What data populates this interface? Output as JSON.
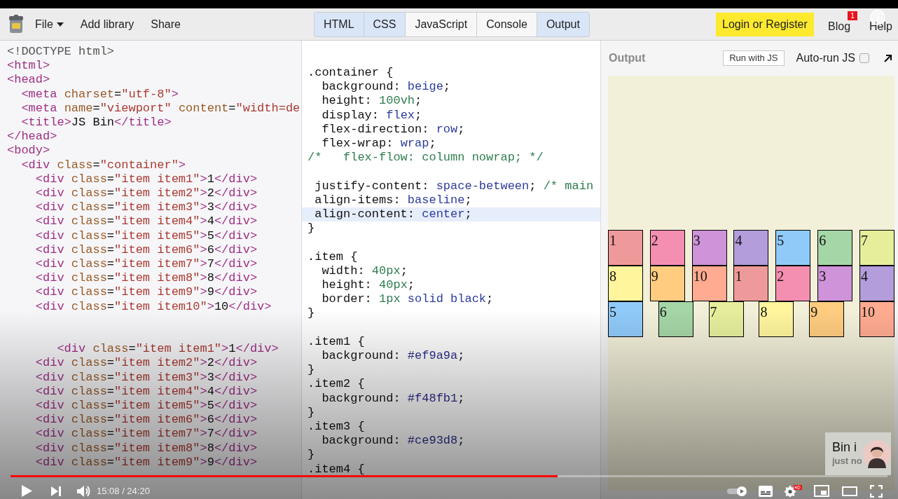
{
  "toolbar": {
    "menu": [
      {
        "label": "File",
        "kind": "dropdown"
      },
      {
        "label": "Add library",
        "kind": "link"
      },
      {
        "label": "Share",
        "kind": "link"
      }
    ],
    "tabs": [
      {
        "label": "HTML",
        "selected": true
      },
      {
        "label": "CSS",
        "selected": true
      },
      {
        "label": "JavaScript",
        "selected": false
      },
      {
        "label": "Console",
        "selected": false
      },
      {
        "label": "Output",
        "selected": true
      }
    ],
    "login": "Login or Register",
    "blog": {
      "label": "Blog",
      "badge": "1"
    },
    "help": "Help"
  },
  "html_editor": {
    "lines": [
      {
        "kind": "code",
        "text": "<!DOCTYPE html>"
      },
      {
        "kind": "code",
        "text": "<html>"
      },
      {
        "kind": "code",
        "text": "<head>"
      },
      {
        "kind": "code",
        "text": "  <meta charset=\"utf-8\">"
      },
      {
        "kind": "code",
        "text": "  <meta name=\"viewport\" content=\"width=de"
      },
      {
        "kind": "code",
        "text": "  <title>JS Bin</title>"
      },
      {
        "kind": "code",
        "text": "</head>"
      },
      {
        "kind": "code",
        "text": "<body>"
      },
      {
        "kind": "code",
        "text": "  <div class=\"container\">"
      },
      {
        "kind": "code",
        "text": "    <div class=\"item item1\">1</div>"
      },
      {
        "kind": "code",
        "text": "    <div class=\"item item2\">2</div>"
      },
      {
        "kind": "code",
        "text": "    <div class=\"item item3\">3</div>"
      },
      {
        "kind": "code",
        "text": "    <div class=\"item item4\">4</div>"
      },
      {
        "kind": "code",
        "text": "    <div class=\"item item5\">5</div>"
      },
      {
        "kind": "code",
        "text": "    <div class=\"item item6\">6</div>"
      },
      {
        "kind": "code",
        "text": "    <div class=\"item item7\">7</div>"
      },
      {
        "kind": "code",
        "text": "    <div class=\"item item8\">8</div>"
      },
      {
        "kind": "code",
        "text": "    <div class=\"item item9\">9</div>"
      },
      {
        "kind": "code",
        "text": "    <div class=\"item item10\">10</div>"
      },
      {
        "kind": "blank"
      },
      {
        "kind": "blank"
      },
      {
        "kind": "code",
        "text": "       <div class=\"item item1\">1</div>"
      },
      {
        "kind": "code",
        "text": "    <div class=\"item item2\">2</div>"
      },
      {
        "kind": "code",
        "text": "    <div class=\"item item3\">3</div>"
      },
      {
        "kind": "code",
        "text": "    <div class=\"item item4\">4</div>"
      },
      {
        "kind": "code",
        "text": "    <div class=\"item item5\">5</div>"
      },
      {
        "kind": "code",
        "text": "    <div class=\"item item6\">6</div>"
      },
      {
        "kind": "code",
        "text": "    <div class=\"item item7\">7</div>"
      },
      {
        "kind": "code",
        "text": "    <div class=\"item item8\">8</div>"
      },
      {
        "kind": "code",
        "text": "    <div class=\"item item9\">9</div>"
      }
    ]
  },
  "css_editor": {
    "lines": [
      {
        "kind": "code",
        "text": ".container {",
        "highlighted": false
      },
      {
        "kind": "code",
        "text": "  background: beige;",
        "highlighted": false
      },
      {
        "kind": "code",
        "text": "  height: 100vh;",
        "highlighted": false
      },
      {
        "kind": "code",
        "text": "  display: flex;",
        "highlighted": false
      },
      {
        "kind": "code",
        "text": "  flex-direction: row;",
        "highlighted": false
      },
      {
        "kind": "code",
        "text": "  flex-wrap: wrap;",
        "highlighted": false
      },
      {
        "kind": "code",
        "text": "/*   flex-flow: column nowrap; */",
        "highlighted": false
      },
      {
        "kind": "code",
        "text": " justify-content: space-between; /* main",
        "highlighted": false,
        "gap_before": true
      },
      {
        "kind": "code",
        "text": " align-items: baseline;",
        "highlighted": false
      },
      {
        "kind": "code",
        "text": " align-content: center;",
        "highlighted": true
      },
      {
        "kind": "code",
        "text": "}",
        "highlighted": false
      },
      {
        "kind": "code",
        "text": ".item {",
        "highlighted": false,
        "gap_before": true
      },
      {
        "kind": "code",
        "text": "  width: 40px;",
        "highlighted": false
      },
      {
        "kind": "code",
        "text": "  height: 40px;",
        "highlighted": false
      },
      {
        "kind": "code",
        "text": "  border: 1px solid black;",
        "highlighted": false
      },
      {
        "kind": "code",
        "text": "}",
        "highlighted": false
      },
      {
        "kind": "code",
        "text": ".item1 {",
        "highlighted": false,
        "gap_before": true
      },
      {
        "kind": "code",
        "text": "  background: #ef9a9a;",
        "highlighted": false
      },
      {
        "kind": "code",
        "text": "}",
        "highlighted": false
      },
      {
        "kind": "code",
        "text": ".item2 {",
        "highlighted": false
      },
      {
        "kind": "code",
        "text": "  background: #f48fb1;",
        "highlighted": false
      },
      {
        "kind": "code",
        "text": "}",
        "highlighted": false
      },
      {
        "kind": "code",
        "text": ".item3 {",
        "highlighted": false
      },
      {
        "kind": "code",
        "text": "  background: #ce93d8;",
        "highlighted": false
      },
      {
        "kind": "code",
        "text": "}",
        "highlighted": false
      },
      {
        "kind": "code",
        "text": ".item4 {",
        "highlighted": false
      }
    ]
  },
  "output": {
    "title": "Output",
    "run_button": "Run with JS",
    "autorun": {
      "label": "Auto-run JS",
      "checked": false
    },
    "boxes": [
      {
        "label": "1",
        "color": "#ef9a9a"
      },
      {
        "label": "2",
        "color": "#f48fb1"
      },
      {
        "label": "3",
        "color": "#ce93d8"
      },
      {
        "label": "4",
        "color": "#b39ddb"
      },
      {
        "label": "5",
        "color": "#90caf9"
      },
      {
        "label": "6",
        "color": "#a5d6a7"
      },
      {
        "label": "7",
        "color": "#e6ee9c"
      },
      {
        "label": "8",
        "color": "#fff59d"
      },
      {
        "label": "9",
        "color": "#ffcc80"
      },
      {
        "label": "10",
        "color": "#ffab91"
      },
      {
        "label": "1",
        "color": "#ef9a9a"
      },
      {
        "label": "2",
        "color": "#f48fb1"
      },
      {
        "label": "3",
        "color": "#ce93d8"
      },
      {
        "label": "4",
        "color": "#b39ddb"
      },
      {
        "label": "5",
        "color": "#90caf9"
      },
      {
        "label": "6",
        "color": "#a5d6a7"
      },
      {
        "label": "7",
        "color": "#e6ee9c"
      },
      {
        "label": "8",
        "color": "#fff59d"
      },
      {
        "label": "9",
        "color": "#ffcc80"
      },
      {
        "label": "10",
        "color": "#ffab91"
      }
    ]
  },
  "toast": {
    "title": "Bin i",
    "subtitle": "just no"
  },
  "player": {
    "progress": {
      "level": 0.624
    },
    "time": "15:08 / 24:20"
  }
}
